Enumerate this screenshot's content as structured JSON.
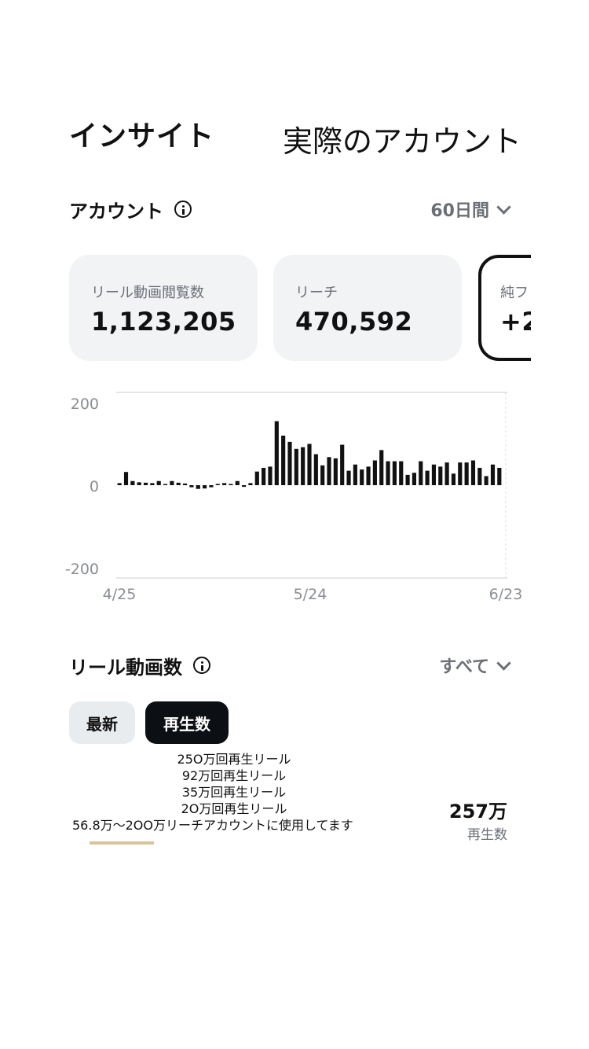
{
  "header": {
    "title": "インサイト",
    "overlay_label": "実際のアカウント"
  },
  "account_section": {
    "title": "アカウント",
    "period": "60日間"
  },
  "metrics": [
    {
      "label": "リール動画閲覧数",
      "value": "1,123,205"
    },
    {
      "label": "リーチ",
      "value": "470,592"
    },
    {
      "label": "純フ",
      "value": "+2"
    }
  ],
  "chart_data": {
    "type": "bar",
    "ylim": [
      -200,
      200
    ],
    "y_ticks": [
      "200",
      "0",
      "-200"
    ],
    "x_ticks": [
      "4/25",
      "5/24",
      "6/23"
    ],
    "grid": true,
    "values": [
      5,
      32,
      10,
      7,
      6,
      5,
      10,
      0,
      10,
      6,
      4,
      -5,
      -9,
      -8,
      -5,
      3,
      5,
      3,
      10,
      -4,
      5,
      33,
      42,
      45,
      155,
      120,
      105,
      88,
      92,
      100,
      75,
      48,
      68,
      65,
      98,
      35,
      50,
      38,
      45,
      60,
      85,
      58,
      58,
      58,
      25,
      30,
      58,
      35,
      50,
      45,
      55,
      28,
      55,
      55,
      60,
      42,
      22,
      50,
      42
    ]
  },
  "reels_section": {
    "title": "リール動画数",
    "filter": "すべて",
    "sort_tabs": [
      "最新",
      "再生数"
    ]
  },
  "notes": [
    "25O万回再生リール",
    "92万回再生リール",
    "35万回再生リール",
    "2O万回再生リール",
    "56.8万〜2OO万リーチアカウントに使用してます"
  ],
  "top_reel": {
    "value": "257万",
    "label": "再生数"
  }
}
